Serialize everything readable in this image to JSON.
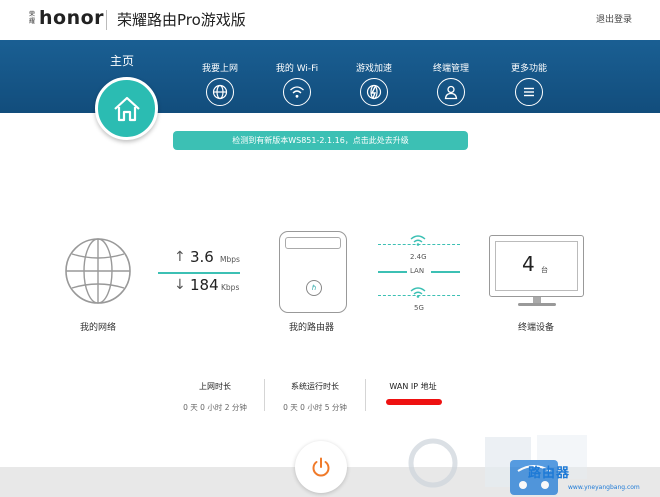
{
  "header": {
    "brand_small": "荣耀",
    "brand_logo": "honor",
    "app_title": "荣耀路由Pro游戏版",
    "logout": "退出登录"
  },
  "nav": {
    "home_label": "主页",
    "items": [
      {
        "label": "我要上网",
        "icon": "globe-icon"
      },
      {
        "label": "我的 Wi-Fi",
        "icon": "wifi-icon"
      },
      {
        "label": "游戏加速",
        "icon": "game-boost-icon"
      },
      {
        "label": "终端管理",
        "icon": "user-icon"
      },
      {
        "label": "更多功能",
        "icon": "menu-icon"
      }
    ]
  },
  "update_banner": "检测到有新版本WS851-2.1.16，点击此处去升级",
  "network": {
    "label": "我的网络",
    "upload_value": "3.6",
    "upload_unit": "Mbps",
    "download_value": "184",
    "download_unit": "Kbps"
  },
  "router": {
    "label": "我的路由器",
    "bands": {
      "band_24": "2.4G",
      "lan": "LAN",
      "band_5": "5G"
    }
  },
  "devices": {
    "count": "4",
    "unit": "台",
    "label": "终端设备"
  },
  "stats": [
    {
      "label": "上网时长",
      "value": "0 天 0 小时 2 分钟"
    },
    {
      "label": "系统运行时长",
      "value": "0 天 0 小时 5 分钟"
    },
    {
      "label": "WAN IP 地址",
      "value": ""
    }
  ],
  "watermark": {
    "text": "路由器",
    "url": "www.yneyangbang.com"
  },
  "colors": {
    "accent": "#3cc0b4",
    "band": "#124d7c",
    "redaction": "#ee1111"
  }
}
